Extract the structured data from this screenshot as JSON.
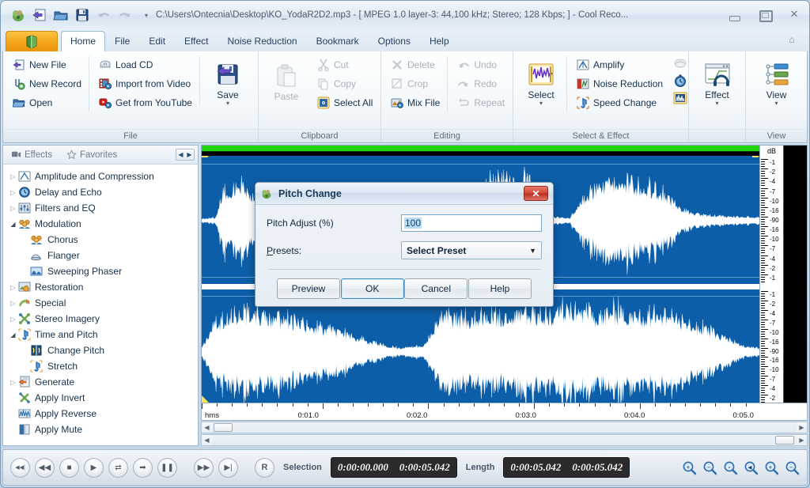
{
  "titlebar": {
    "text": "C:\\Users\\Ontecnia\\Desktop\\KO_YodaR2D2.mp3 - [ MPEG 1.0 layer-3: 44,100 kHz; Stereo; 128 Kbps;  ] - Cool Reco...",
    "quick_access": [
      "app-icon",
      "new-file-icon",
      "open-icon",
      "save-icon",
      "undo-icon",
      "redo-icon"
    ],
    "dropdown_glyph": "▾",
    "minimize": "minimize-icon",
    "maximize": "maximize-icon",
    "close": "✕"
  },
  "tabs": [
    {
      "label": "Home",
      "active": true
    },
    {
      "label": "File",
      "active": false
    },
    {
      "label": "Edit",
      "active": false
    },
    {
      "label": "Effect",
      "active": false
    },
    {
      "label": "Noise Reduction",
      "active": false
    },
    {
      "label": "Bookmark",
      "active": false
    },
    {
      "label": "Options",
      "active": false
    },
    {
      "label": "Help",
      "active": false
    }
  ],
  "ribbon": {
    "groups": [
      {
        "name": "File",
        "label": "File",
        "col1": [
          {
            "label": "New File",
            "icon": "new-file-icon",
            "accel": "N",
            "disabled": false
          },
          {
            "label": "New Record",
            "icon": "new-record-icon",
            "accel": "R",
            "disabled": false
          },
          {
            "label": "Open",
            "icon": "open-icon",
            "accel": "O",
            "disabled": false
          }
        ],
        "col2": [
          {
            "label": "Load CD",
            "icon": "cd-icon",
            "accel": "L",
            "disabled": false
          },
          {
            "label": "Import from Video",
            "icon": "video-icon",
            "accel": "I",
            "disabled": false
          },
          {
            "label": "Get from YouTube",
            "icon": "youtube-icon",
            "accel": "G",
            "disabled": false
          }
        ],
        "big": {
          "label": "Save",
          "icon": "save-big-icon",
          "accel": "S",
          "caret": "▾"
        }
      },
      {
        "name": "Clipboard",
        "label": "Clipboard",
        "big": {
          "label": "Paste",
          "icon": "paste-icon",
          "accel": "P",
          "disabled": true
        },
        "col1": [
          {
            "label": "Cut",
            "icon": "cut-icon",
            "accel": "",
            "disabled": true
          },
          {
            "label": "Copy",
            "icon": "copy-icon",
            "accel": "C",
            "disabled": true
          },
          {
            "label": "Select All",
            "icon": "select-all-icon",
            "accel": "S",
            "disabled": false
          }
        ]
      },
      {
        "name": "Editing",
        "label": "Editing",
        "col1": [
          {
            "label": "Delete",
            "icon": "delete-icon",
            "accel": "D",
            "disabled": true
          },
          {
            "label": "Crop",
            "icon": "crop-icon",
            "accel": "C",
            "disabled": true
          },
          {
            "label": "Mix File",
            "icon": "mix-file-icon",
            "accel": "M",
            "disabled": false
          }
        ],
        "col2": [
          {
            "label": "Undo",
            "icon": "undo-icon",
            "accel": "U",
            "disabled": true
          },
          {
            "label": "Redo",
            "icon": "redo-icon",
            "accel": "",
            "disabled": true
          },
          {
            "label": "Repeat",
            "icon": "repeat-icon",
            "accel": "R",
            "disabled": true
          }
        ]
      },
      {
        "name": "Select & Effect",
        "label": "Select & Effect",
        "big": {
          "label": "Select",
          "icon": "select-big-icon",
          "accel": "S",
          "caret": "▾"
        },
        "col1": [
          {
            "label": "Amplify",
            "icon": "amplify-icon",
            "accel": "A",
            "disabled": false
          },
          {
            "label": "Noise Reduction",
            "icon": "noise-reduction-icon",
            "accel": "N",
            "disabled": false
          },
          {
            "label": "Speed Change",
            "icon": "speed-change-icon",
            "accel": "e",
            "disabled": false
          }
        ],
        "icons_col": [
          "fade-icon",
          "delay-icon",
          "equalizer-icon"
        ]
      },
      {
        "name": "Effect",
        "label": "",
        "big": {
          "label": "Effect",
          "icon": "effect-big-icon",
          "accel": "E",
          "caret": "▾"
        }
      },
      {
        "name": "View",
        "label": "View",
        "big": {
          "label": "View",
          "icon": "view-big-icon",
          "accel": "V",
          "caret": "▾"
        }
      }
    ]
  },
  "sidebar": {
    "tabs": [
      {
        "label": "Effects",
        "icon": "effects-icon",
        "active": true
      },
      {
        "label": "Favorites",
        "icon": "star-icon",
        "active": false
      }
    ],
    "nav_left": "◀",
    "nav_right": "▶",
    "tree": [
      {
        "label": "Amplitude and Compression",
        "icon": "amplitude-icon",
        "level": 0,
        "state": "collapsed"
      },
      {
        "label": "Delay and Echo",
        "icon": "delay-echo-icon",
        "level": 0,
        "state": "collapsed"
      },
      {
        "label": "Filters and EQ",
        "icon": "filters-eq-icon",
        "level": 0,
        "state": "collapsed"
      },
      {
        "label": "Modulation",
        "icon": "modulation-icon",
        "level": 0,
        "state": "expanded"
      },
      {
        "label": "Chorus",
        "icon": "chorus-icon",
        "level": 1,
        "state": "leaf"
      },
      {
        "label": "Flanger",
        "icon": "flanger-icon",
        "level": 1,
        "state": "leaf"
      },
      {
        "label": "Sweeping Phaser",
        "icon": "phaser-icon",
        "level": 1,
        "state": "leaf"
      },
      {
        "label": "Restoration",
        "icon": "restoration-icon",
        "level": 0,
        "state": "collapsed"
      },
      {
        "label": "Special",
        "icon": "special-icon",
        "level": 0,
        "state": "collapsed"
      },
      {
        "label": "Stereo Imagery",
        "icon": "stereo-imagery-icon",
        "level": 0,
        "state": "collapsed"
      },
      {
        "label": "Time and Pitch",
        "icon": "time-pitch-icon",
        "level": 0,
        "state": "expanded"
      },
      {
        "label": "Change Pitch",
        "icon": "change-pitch-icon",
        "level": 1,
        "state": "leaf"
      },
      {
        "label": "Stretch",
        "icon": "stretch-icon",
        "level": 1,
        "state": "leaf"
      },
      {
        "label": "Generate",
        "icon": "generate-icon",
        "level": 0,
        "state": "collapsed"
      },
      {
        "label": "Apply Invert",
        "icon": "apply-invert-icon",
        "level": 0,
        "state": "leaf"
      },
      {
        "label": "Apply Reverse",
        "icon": "apply-reverse-icon",
        "level": 0,
        "state": "leaf"
      },
      {
        "label": "Apply Mute",
        "icon": "apply-mute-icon",
        "level": 0,
        "state": "leaf"
      }
    ]
  },
  "waveform": {
    "db_title": "dB",
    "db_ticks": [
      "-1",
      "-2",
      "-4",
      "-7",
      "-10",
      "-16",
      "-90",
      "-16",
      "-10",
      "-7",
      "-4",
      "-2",
      "-1"
    ],
    "ruler_unit": "hms",
    "ruler_labels": [
      "0:01.0",
      "0:02.0",
      "0:03.0",
      "0:04.0",
      "0:05.0"
    ],
    "accent_green": "#22d411",
    "wave_bg": "#0d5ea8",
    "wave_fg": "#ffffff"
  },
  "statusbar": {
    "transport": [
      {
        "name": "skip-back-button",
        "glyph": "◀◀|"
      },
      {
        "name": "rewind-button",
        "glyph": "◀◀"
      },
      {
        "name": "stop-button",
        "glyph": "■"
      },
      {
        "name": "play-button",
        "glyph": "▶"
      },
      {
        "name": "loop-button",
        "glyph": "⇄"
      },
      {
        "name": "forward-arrow-button",
        "glyph": "➡"
      },
      {
        "name": "pause-button",
        "glyph": "❚❚"
      },
      {
        "name": "fast-forward-button",
        "glyph": "▶▶"
      },
      {
        "name": "skip-forward-button",
        "glyph": "▶|"
      },
      {
        "name": "record-button",
        "glyph": "R"
      }
    ],
    "selection_label": "Selection",
    "selection_start": "0:00:00.000",
    "selection_end": "0:00:05.042",
    "length_label": "Length",
    "length_value": "0:00:05.042",
    "length_total": "0:00:05.042",
    "zoom_buttons": [
      "zoom-in-icon",
      "zoom-out-icon",
      "zoom-selection-icon",
      "zoom-full-icon",
      "zoom-vert-in-icon",
      "zoom-vert-out-icon"
    ]
  },
  "dialog": {
    "title": "Pitch Change",
    "icon": "pitch-change-icon",
    "close": "✕",
    "field_label": "Pitch Adjust (%)",
    "field_value": "100",
    "presets_label": "Presets:",
    "presets_accel": "P",
    "presets_value": "Select Preset",
    "presets_caret": "▼",
    "buttons": [
      {
        "label": "Preview",
        "primary": false
      },
      {
        "label": "OK",
        "primary": true
      },
      {
        "label": "Cancel",
        "primary": false
      },
      {
        "label": "Help",
        "primary": false
      }
    ]
  }
}
